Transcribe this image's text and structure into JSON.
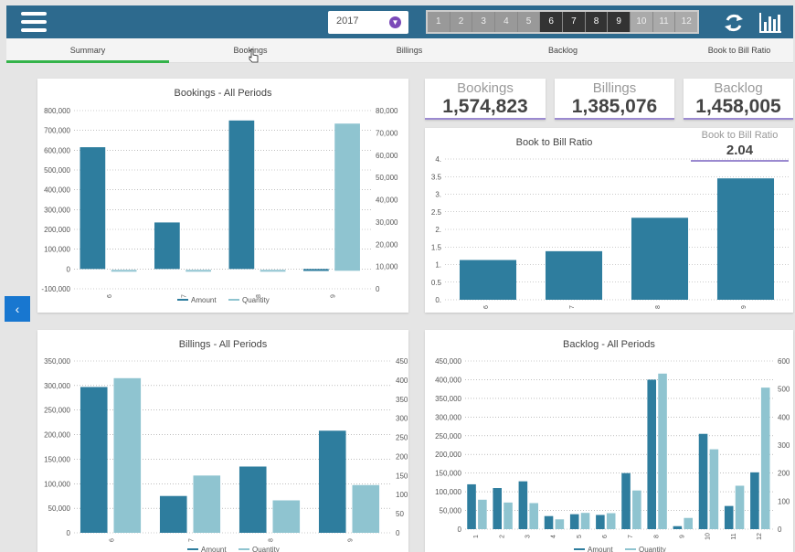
{
  "header": {
    "year": "2017",
    "periods": [
      "1",
      "2",
      "3",
      "4",
      "5",
      "6",
      "7",
      "8",
      "9",
      "10",
      "11",
      "12"
    ],
    "active_periods": [
      "6",
      "7",
      "8",
      "9"
    ]
  },
  "tabs": [
    {
      "label": "Summary",
      "active": true
    },
    {
      "label": "Bookings",
      "active": false
    },
    {
      "label": "Billings",
      "active": false
    },
    {
      "label": "Backlog",
      "active": false
    },
    {
      "label": "Book to Bill Ratio",
      "active": false
    }
  ],
  "kpis": {
    "bookings": {
      "label": "Bookings",
      "value": "1,574,823"
    },
    "billings": {
      "label": "Billings",
      "value": "1,385,076"
    },
    "backlog": {
      "label": "Backlog",
      "value": "1,458,005"
    },
    "ratio": {
      "label": "Book to Bill Ratio",
      "value": "2.04"
    }
  },
  "colors": {
    "amount": "#2e7d9e",
    "quantity": "#8fc4d0",
    "accent": "#2d6a8e",
    "active_tab": "#34b34a"
  },
  "chart_data": [
    {
      "id": "bookings",
      "type": "bar",
      "title": "Bookings - All Periods",
      "categories": [
        "6",
        "7",
        "8",
        "9"
      ],
      "series": [
        {
          "name": "Amount",
          "axis": "left",
          "values": [
            615000,
            235000,
            750000,
            -10000
          ]
        },
        {
          "name": "Quantity",
          "axis": "right",
          "values": [
            0,
            0,
            0,
            73500
          ]
        }
      ],
      "left_ticks": [
        "800,000",
        "700,000",
        "600,000",
        "500,000",
        "400,000",
        "300,000",
        "200,000",
        "100,000",
        "0",
        "-100,000"
      ],
      "right_ticks": [
        "80,000",
        "70,000",
        "60,000",
        "50,000",
        "40,000",
        "30,000",
        "20,000",
        "10,000",
        "0"
      ],
      "ylim_left": [
        -100000,
        800000
      ],
      "ylim_right": [
        -9000,
        80000
      ],
      "legend": "bottom"
    },
    {
      "id": "ratio",
      "type": "bar",
      "title": "Book to Bill Ratio",
      "categories": [
        "6",
        "7",
        "8",
        "9"
      ],
      "series": [
        {
          "values": [
            1.13,
            1.38,
            2.33,
            3.45
          ]
        }
      ],
      "left_ticks": [
        "4.",
        "3.5",
        "3.",
        "2.5",
        "2.",
        "1.5",
        "1.",
        "0.5",
        "0."
      ],
      "ylim_left": [
        0,
        4
      ],
      "legend": "none"
    },
    {
      "id": "billings",
      "type": "bar",
      "title": "Billings - All Periods",
      "categories": [
        "6",
        "7",
        "8",
        "9"
      ],
      "series": [
        {
          "name": "Amount",
          "axis": "left",
          "values": [
            297000,
            75000,
            135000,
            208000
          ]
        },
        {
          "name": "Quantity",
          "axis": "right",
          "values": [
            405,
            150,
            85,
            125
          ]
        }
      ],
      "left_ticks": [
        "350,000",
        "300,000",
        "250,000",
        "200,000",
        "150,000",
        "100,000",
        "50,000",
        "0"
      ],
      "right_ticks": [
        "450",
        "400",
        "350",
        "300",
        "250",
        "200",
        "150",
        "100",
        "50",
        "0"
      ],
      "ylim_left": [
        0,
        350000
      ],
      "ylim_right": [
        0,
        450
      ],
      "legend": "bottom"
    },
    {
      "id": "backlog",
      "type": "bar",
      "title": "Backlog - All Periods",
      "categories": [
        "1",
        "2",
        "3",
        "4",
        "5",
        "6",
        "7",
        "8",
        "9",
        "10",
        "11",
        "12"
      ],
      "series": [
        {
          "name": "Amount",
          "axis": "left",
          "values": [
            120000,
            110000,
            128000,
            35000,
            40000,
            38000,
            150000,
            400000,
            8000,
            255000,
            62000,
            152000
          ]
        },
        {
          "name": "Quantity",
          "axis": "right",
          "values": [
            105,
            95,
            93,
            35,
            58,
            57,
            138,
            555,
            40,
            285,
            155,
            505
          ]
        }
      ],
      "left_ticks": [
        "450,000",
        "400,000",
        "350,000",
        "300,000",
        "250,000",
        "200,000",
        "150,000",
        "100,000",
        "50,000",
        "0"
      ],
      "right_ticks": [
        "600",
        "500",
        "400",
        "300",
        "200",
        "100",
        "0"
      ],
      "ylim_left": [
        0,
        450000
      ],
      "ylim_right": [
        0,
        600
      ],
      "legend": "bottom"
    }
  ]
}
